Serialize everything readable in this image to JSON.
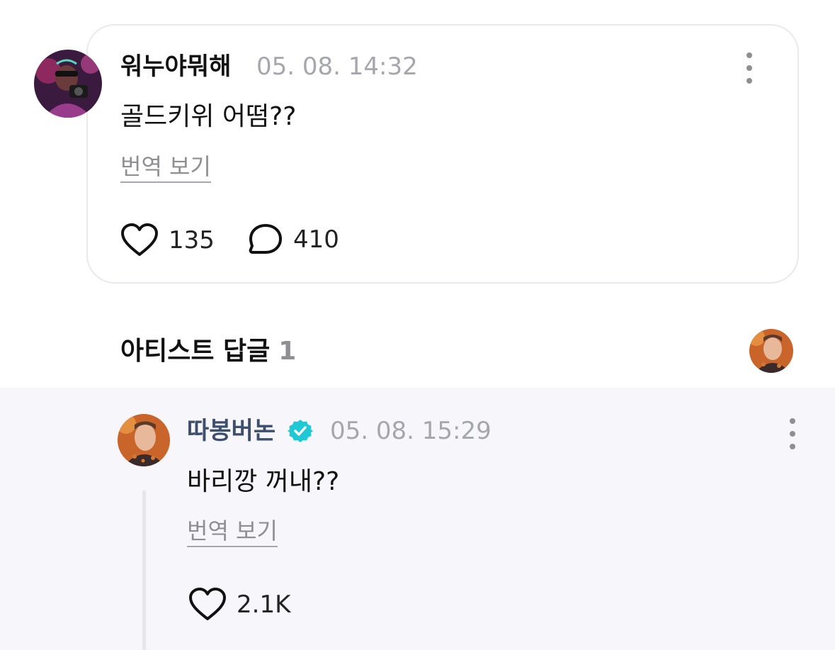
{
  "post": {
    "author": "워누야뭐해",
    "timestamp": "05. 08. 14:32",
    "text": "골드키위 어떰??",
    "translate_label": "번역 보기",
    "like_count": "135",
    "comment_count": "410"
  },
  "artist_replies": {
    "title": "아티스트 답글",
    "count": "1"
  },
  "reply": {
    "author": "따봉버논",
    "verified": true,
    "timestamp": "05. 08. 15:29",
    "text": "바리깡 꺼내??",
    "translate_label": "번역 보기",
    "like_count": "2.1K"
  },
  "icons": {
    "like": "heart-icon",
    "comment": "speech-bubble-icon",
    "more": "more-vertical-icon",
    "verified": "verified-badge-icon"
  },
  "colors": {
    "verified_badge": "#1ec8d4",
    "muted_text": "#a6a6ad",
    "reply_background": "#f7f7fb",
    "artist_name": "#3d4f6b"
  }
}
